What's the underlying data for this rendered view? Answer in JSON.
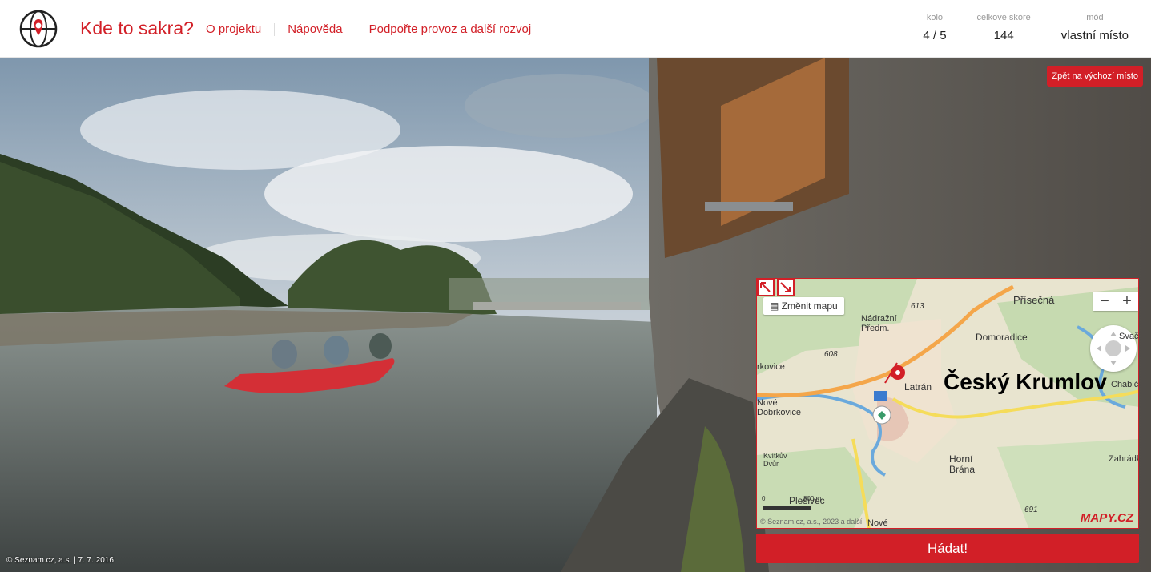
{
  "header": {
    "app_title": "Kde to sakra?",
    "nav": [
      "O projektu",
      "Nápověda",
      "Podpořte provoz a další rozvoj"
    ],
    "stats": [
      {
        "label": "kolo",
        "value": "4 / 5"
      },
      {
        "label": "celkové skóre",
        "value": "144"
      },
      {
        "label": "mód",
        "value": "vlastní místo"
      }
    ]
  },
  "panorama": {
    "back_button": "Zpět na výchozí místo",
    "copyright": "© Seznam.cz, a.s. | 7. 7. 2016"
  },
  "map": {
    "change_map_label": "Změnit mapu",
    "zoom_out": "−",
    "zoom_in": "+",
    "city": "Český Krumlov",
    "labels": [
      "Přísečná",
      "613",
      "Nádražní Předm.",
      "Domoradice",
      "Svač",
      "608",
      "Latrán",
      "rkovice",
      "Chabič",
      "Nové Dobrkovice",
      "Kvítkův Dvůr",
      "Horní Brána",
      "Zahrádk",
      "Plešivec",
      "691",
      "Nové"
    ],
    "scale_start": "0",
    "scale_end": "800 m",
    "copyright": "© Seznam.cz, a.s., 2023 a další",
    "logo": "MAPY.CZ"
  },
  "guess_button": "Hádat!",
  "colors": {
    "accent": "#d21f27"
  }
}
